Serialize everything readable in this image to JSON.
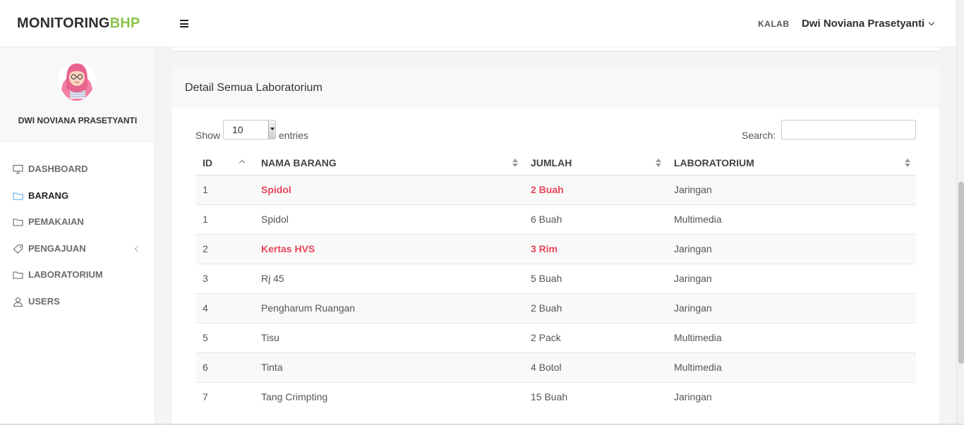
{
  "brand": {
    "main": "MONITORING",
    "accent": "BHP"
  },
  "header": {
    "role": "KALAB",
    "user_name": "Dwi Noviana Prasetyanti"
  },
  "sidebar": {
    "profile_name": "DWI NOVIANA PRASETYANTI",
    "items": [
      {
        "label": "DASHBOARD",
        "icon": "monitor-icon"
      },
      {
        "label": "BARANG",
        "icon": "folder-icon"
      },
      {
        "label": "PEMAKAIAN",
        "icon": "folder-icon"
      },
      {
        "label": "PENGAJUAN",
        "icon": "tag-icon"
      },
      {
        "label": "LABORATORIUM",
        "icon": "folder-icon"
      },
      {
        "label": "USERS",
        "icon": "user-icon"
      }
    ]
  },
  "card": {
    "title": "Detail Semua Laboratorium"
  },
  "table_controls": {
    "show_label": "Show",
    "entries_value": "10",
    "entries_label": "entries",
    "search_label": "Search:",
    "search_value": ""
  },
  "table": {
    "columns": [
      "ID",
      "NAMA BARANG",
      "JUMLAH",
      "LABORATORIUM"
    ],
    "rows": [
      {
        "id": "1",
        "nama": "Spidol",
        "jumlah": "2 Buah",
        "lab": "Jaringan"
      },
      {
        "id": "1",
        "nama": "Spidol",
        "jumlah": "6 Buah",
        "lab": "Multimedia"
      },
      {
        "id": "2",
        "nama": "Kertas HVS",
        "jumlah": "3 Rim",
        "lab": "Jaringan"
      },
      {
        "id": "3",
        "nama": "Rj 45",
        "jumlah": "5 Buah",
        "lab": "Jaringan"
      },
      {
        "id": "4",
        "nama": "Pengharum Ruangan",
        "jumlah": "2 Buah",
        "lab": "Jaringan"
      },
      {
        "id": "5",
        "nama": "Tisu",
        "jumlah": "2 Pack",
        "lab": "Multimedia"
      },
      {
        "id": "6",
        "nama": "Tinta",
        "jumlah": "4 Botol",
        "lab": "Multimedia"
      },
      {
        "id": "7",
        "nama": "Tang Crimpting",
        "jumlah": "15 Buah",
        "lab": "Jaringan"
      }
    ]
  },
  "colors": {
    "accent": "#8bc34a",
    "highlight": "#e8455a",
    "active_icon": "#5aa9e6"
  }
}
